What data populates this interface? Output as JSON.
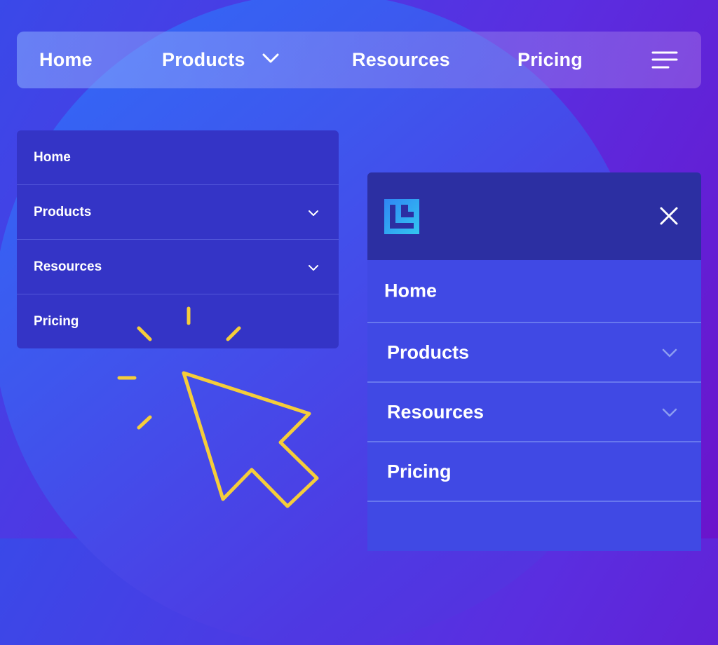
{
  "topnav": {
    "items": [
      "Home",
      "Products",
      "Resources",
      "Pricing"
    ],
    "icons": {
      "dropdown": "chevron-down-icon",
      "menu": "hamburger-menu-icon"
    }
  },
  "dropdown_menu": {
    "items": [
      {
        "label": "Home",
        "has_submenu": false
      },
      {
        "label": "Products",
        "has_submenu": true
      },
      {
        "label": "Resources",
        "has_submenu": true
      },
      {
        "label": "Pricing",
        "has_submenu": false
      }
    ]
  },
  "mobile_menu": {
    "logo": "brand-logo-icon",
    "close_icon": "close-icon",
    "items": [
      {
        "label": "Home",
        "has_submenu": false
      },
      {
        "label": "Products",
        "has_submenu": true
      },
      {
        "label": "Resources",
        "has_submenu": true
      },
      {
        "label": "Pricing",
        "has_submenu": false
      }
    ]
  },
  "decoration": {
    "cursor": "click-cursor-icon",
    "cursor_color": "#f5cd3a"
  },
  "colors": {
    "background_start": "#2f6cf8",
    "background_end": "#6a14cc",
    "dropdown_bg": "#3434c6",
    "mobile_header_bg": "#2c2fa2",
    "mobile_body_bg": "#4049e4"
  }
}
